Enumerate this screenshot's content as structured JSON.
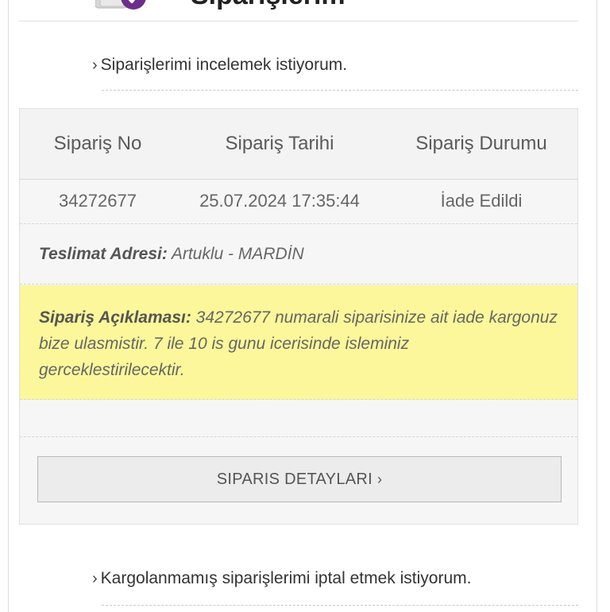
{
  "header": {
    "title": "Siparişlerim",
    "icon": "shopping-bag-check-icon",
    "accent_color": "#6b2f8a"
  },
  "links": {
    "review_orders": "Siparişlerimi incelemek istiyorum.",
    "cancel_unshipped": "Kargolanmamış siparişlerimi iptal etmek istiyorum."
  },
  "order_table": {
    "headers": [
      "Sipariş No",
      "Sipariş Tarihi",
      "Sipariş Durumu"
    ],
    "row": {
      "order_no": "34272677",
      "order_date": "25.07.2024 17:35:44",
      "order_status": "İade Edildi"
    }
  },
  "address": {
    "label": "Teslimat Adresi:",
    "value": "Artuklu - MARDİN"
  },
  "note": {
    "label": "Sipariş Açıklaması:",
    "text": "34272677 numarali siparisinize ait iade kargonuz bize ulasmistir. 7 ile 10 is gunu icerisinde isleminiz gerceklestirilecektir.",
    "highlight_color": "#fbf79a"
  },
  "details_button": {
    "label": "SIPARIS DETAYLARI",
    "chevron": "›"
  },
  "chevron": "›"
}
